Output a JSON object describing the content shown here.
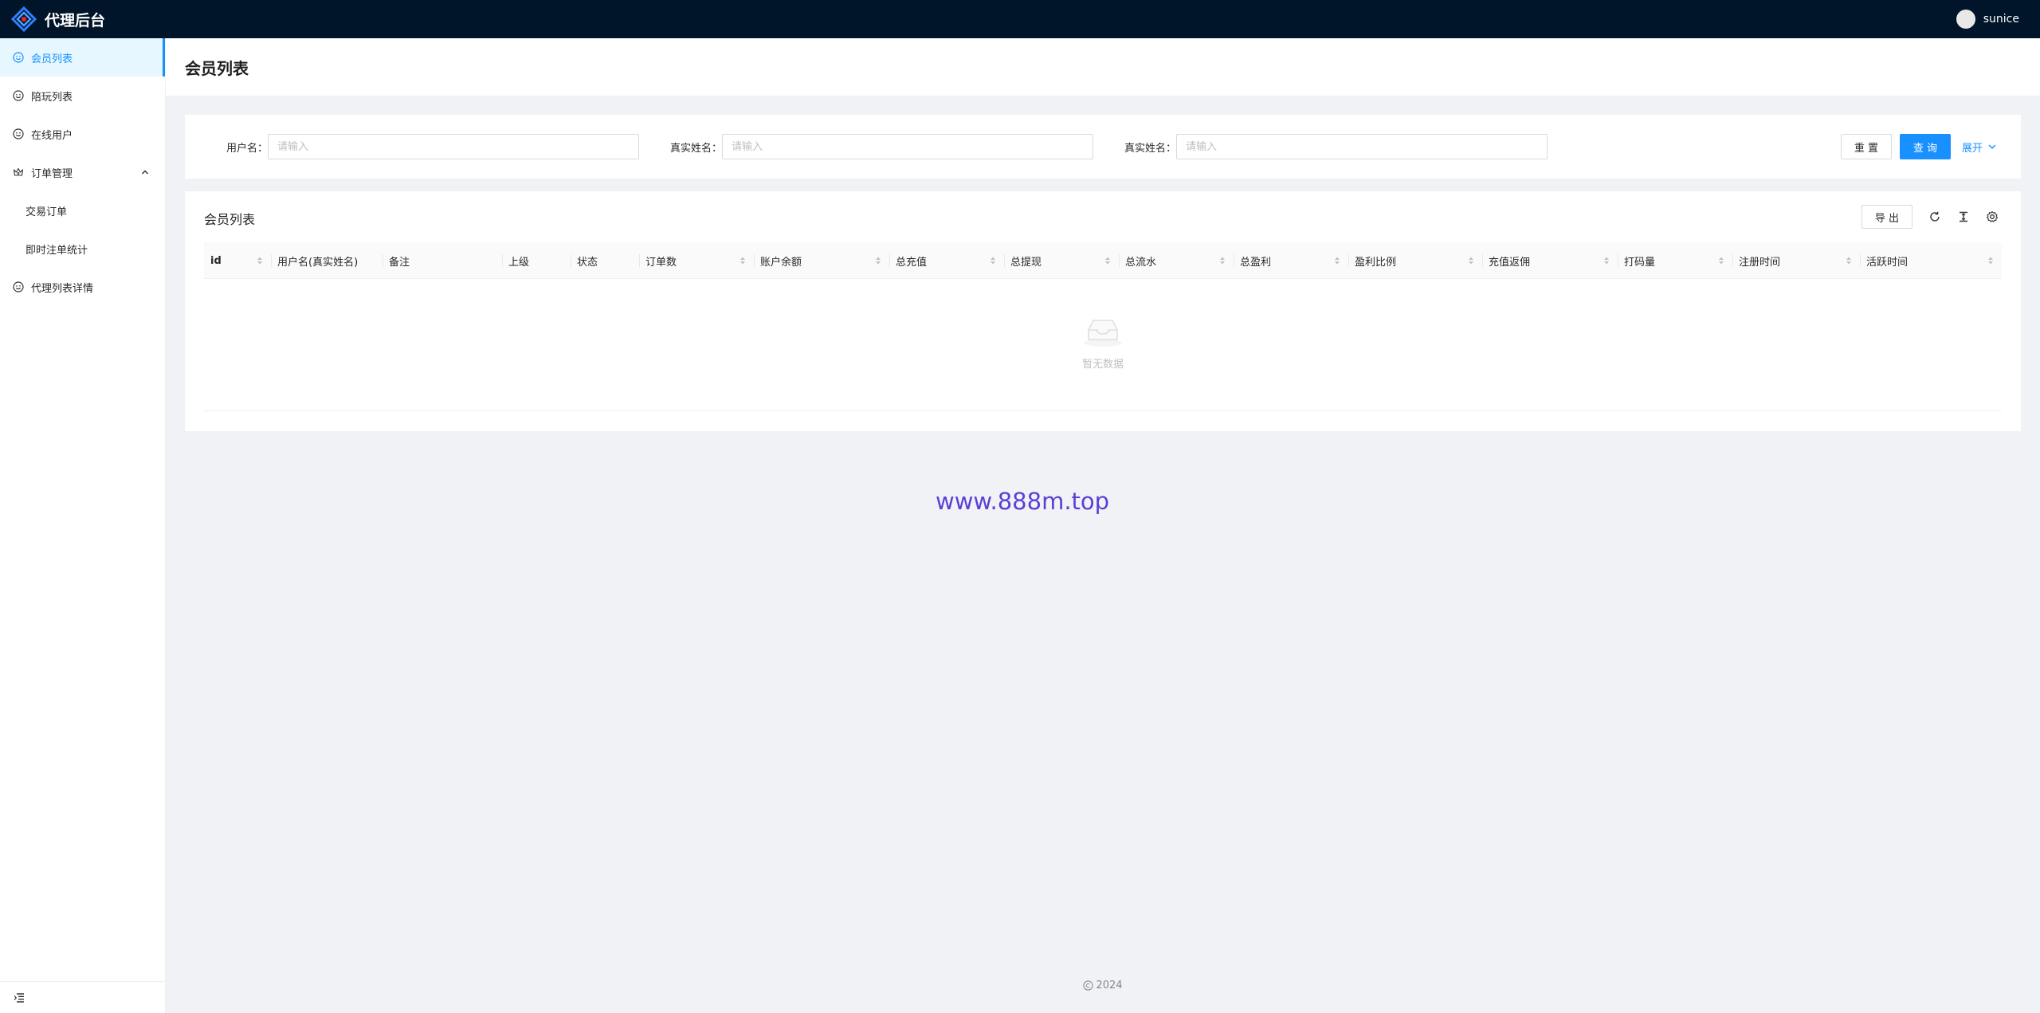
{
  "app": {
    "title": "代理后台",
    "user": "sunice"
  },
  "sidebar": {
    "items": [
      {
        "label": "会员列表",
        "icon": "smile-icon",
        "active": true
      },
      {
        "label": "陪玩列表",
        "icon": "smile-icon"
      },
      {
        "label": "在线用户",
        "icon": "smile-icon"
      },
      {
        "label": "订单管理",
        "icon": "crown-icon",
        "expanded": true
      },
      {
        "label": "交易订单"
      },
      {
        "label": "即时注单统计"
      },
      {
        "label": "代理列表详情",
        "icon": "smile-icon"
      }
    ],
    "collapse_icon": "menu-fold-icon"
  },
  "page": {
    "title": "会员列表"
  },
  "search": {
    "username_label": "用户名",
    "username_placeholder": "请输入",
    "realname_label": "真实姓名",
    "realname_placeholder": "请输入",
    "realname2_label": "真实姓名",
    "realname2_placeholder": "请输入",
    "reset_label": "重 置",
    "query_label": "查 询",
    "expand_label": "展开"
  },
  "table": {
    "title": "会员列表",
    "export_label": "导 出",
    "columns": [
      {
        "label": "id",
        "sortable": true
      },
      {
        "label": "用户名(真实姓名)",
        "sortable": false
      },
      {
        "label": "备注",
        "sortable": false
      },
      {
        "label": "上级",
        "sortable": false
      },
      {
        "label": "状态",
        "sortable": false
      },
      {
        "label": "订单数",
        "sortable": true
      },
      {
        "label": "账户余额",
        "sortable": true
      },
      {
        "label": "总充值",
        "sortable": true
      },
      {
        "label": "总提现",
        "sortable": true
      },
      {
        "label": "总流水",
        "sortable": true
      },
      {
        "label": "总盈利",
        "sortable": true
      },
      {
        "label": "盈利比例",
        "sortable": true
      },
      {
        "label": "充值返佣",
        "sortable": true
      },
      {
        "label": "打码量",
        "sortable": true
      },
      {
        "label": "注册时间",
        "sortable": true
      },
      {
        "label": "活跃时间",
        "sortable": true
      }
    ],
    "empty_text": "暂无数据"
  },
  "watermark": "www.888m.top",
  "footer": {
    "copyright": "2024"
  },
  "colors": {
    "header_bg": "#001529",
    "primary": "#1890ff",
    "page_bg": "#f0f2f5",
    "watermark": "#5b3fd6"
  }
}
